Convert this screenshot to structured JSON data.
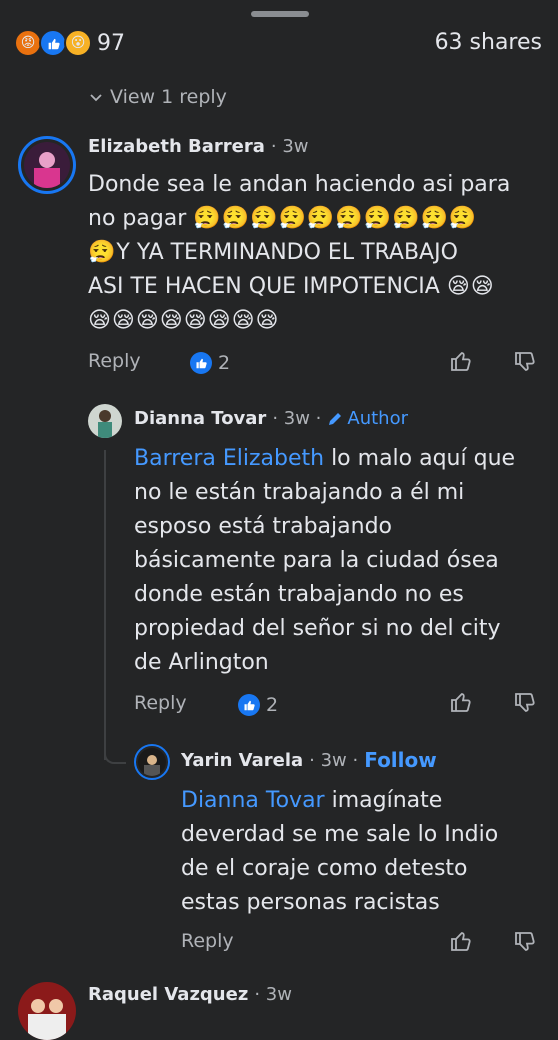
{
  "header": {
    "reaction_count": "97",
    "shares": "63 shares",
    "view_reply": "View 1 reply"
  },
  "comments": [
    {
      "author": "Elizabeth Barrera",
      "time": "· 3w",
      "text_line1": "Donde sea le andan haciendo asi para",
      "text_line2_prefix": "no pagar",
      "emoji_row1": "😮‍💨😮‍💨😮‍💨😮‍💨😮‍💨😮‍💨😮‍💨😮‍💨😮‍💨😮‍💨",
      "emoji_prefix3": "😮‍💨",
      "text_line3": "Y YA TERMINANDO EL TRABAJO",
      "text_line4": "ASI TE HACEN QUE IMPOTENCIA",
      "emoji_line4": "😪😪",
      "emoji_line5": "😪😪😪😪😪😪😪😪",
      "reply": "Reply",
      "likes": "2"
    },
    {
      "author": "Dianna Tovar",
      "time": "· 3w ·",
      "badge": "Author",
      "mention": "Barrera Elizabeth",
      "line1": " lo malo aquí que",
      "line2": "no le están trabajando a él mi",
      "line3": "esposo está trabajando",
      "line4": "básicamente para la ciudad ósea",
      "line5": "donde están trabajando no es",
      "line6": "propiedad del señor si no del city",
      "line7": "de Arlington",
      "reply": "Reply",
      "likes": "2"
    },
    {
      "author": "Yarin Varela",
      "time": "· 3w ·",
      "follow": "Follow",
      "mention": "Dianna Tovar",
      "line1": " imagínate",
      "line2": "deverdad se me sale lo Indio",
      "line3": "de el coraje como detesto",
      "line4": "estas personas  racistas",
      "reply": "Reply"
    },
    {
      "author": "Raquel Vazquez",
      "time": "· 3w"
    }
  ],
  "colors": {
    "background": "#242526",
    "link": "#4599ff",
    "like": "#1877f2"
  }
}
